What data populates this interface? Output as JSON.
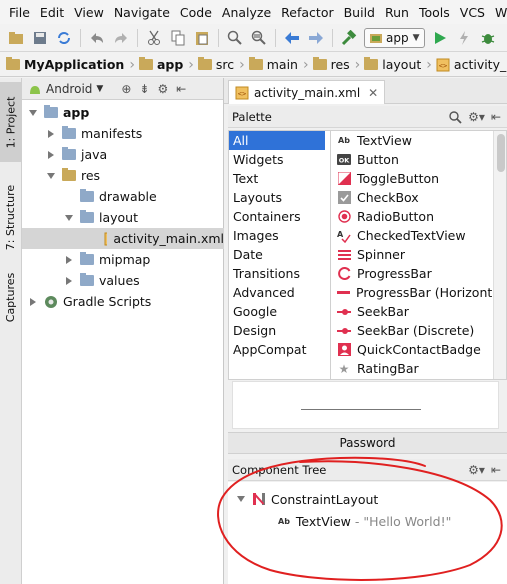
{
  "menu": [
    "File",
    "Edit",
    "View",
    "Navigate",
    "Code",
    "Analyze",
    "Refactor",
    "Build",
    "Run",
    "Tools",
    "VCS",
    "Window"
  ],
  "toolbar": {
    "run_config": "app"
  },
  "breadcrumb": [
    "MyApplication",
    "app",
    "src",
    "main",
    "res",
    "layout",
    "activity_main.xml"
  ],
  "left_strip": {
    "project": "1: Project",
    "structure": "7: Structure",
    "captures": "Captures"
  },
  "project_panel": {
    "view_mode": "Android",
    "tree": {
      "app": "app",
      "manifests": "manifests",
      "java": "java",
      "res": "res",
      "drawable": "drawable",
      "layout": "layout",
      "activity_main": "activity_main.xml",
      "mipmap": "mipmap",
      "values": "values",
      "gradle": "Gradle Scripts"
    }
  },
  "editor": {
    "tab_label": "activity_main.xml"
  },
  "palette": {
    "title": "Palette",
    "categories": [
      "All",
      "Widgets",
      "Text",
      "Layouts",
      "Containers",
      "Images",
      "Date",
      "Transitions",
      "Advanced",
      "Google",
      "Design",
      "AppCompat"
    ],
    "selected_category": "All",
    "widgets": [
      "TextView",
      "Button",
      "ToggleButton",
      "CheckBox",
      "RadioButton",
      "CheckedTextView",
      "Spinner",
      "ProgressBar",
      "ProgressBar (Horizontal)",
      "SeekBar",
      "SeekBar (Discrete)",
      "QuickContactBadge",
      "RatingBar"
    ],
    "widget_icons": [
      "textview-icon",
      "button-icon",
      "togglebutton-icon",
      "checkbox-icon",
      "radiobutton-icon",
      "checkedtextview-icon",
      "spinner-icon",
      "progressbar-icon",
      "progressbar-horizontal-icon",
      "seekbar-icon",
      "seekbar-discrete-icon",
      "quickcontactbadge-icon",
      "ratingbar-icon"
    ]
  },
  "password_label": "Password",
  "component_tree": {
    "title": "Component Tree",
    "root": "ConstraintLayout",
    "child_name": "TextView",
    "child_dash": "- ",
    "child_value": "\"Hello World!\""
  },
  "colors": {
    "accent": "#2f72d8",
    "annotation": "#e02020",
    "widget_red": "#e03050"
  }
}
